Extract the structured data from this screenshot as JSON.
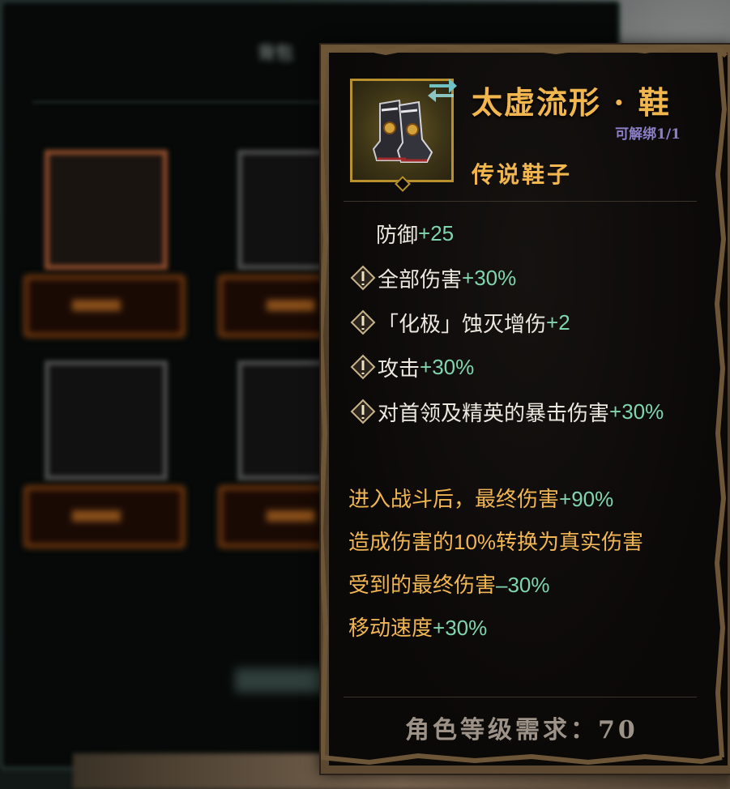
{
  "background": {
    "panel_title": "背包"
  },
  "tooltip": {
    "item_name": "太虚流形 · 鞋",
    "bind_status": "可解绑1/1",
    "item_type": "传说鞋子",
    "item_icon": "boots-icon",
    "swap_icon": "swap-arrows-icon",
    "base_stat": {
      "label": "防御",
      "bonus": "+25"
    },
    "affixes": [
      {
        "label": "全部伤害",
        "bonus": "+30%"
      },
      {
        "label": "「化极」蚀灭增伤",
        "bonus": "+2"
      },
      {
        "label": "攻击",
        "bonus": "+30%"
      },
      {
        "label": "对首领及精英的暴击伤害",
        "bonus": "+30%"
      }
    ],
    "special_effects": [
      {
        "text": "进入战斗后，最终伤害",
        "bonus": "+90%",
        "suffix": ""
      },
      {
        "text": "造成伤害的10%转换为真实伤害",
        "bonus": "",
        "suffix": ""
      },
      {
        "text": "受到的最终伤害",
        "bonus": "–30%",
        "suffix": ""
      },
      {
        "text": "移动速度",
        "bonus": "+30%",
        "suffix": ""
      }
    ],
    "requirement": "角色等级需求：70"
  },
  "colors": {
    "legendary_gold": "#f2b64e",
    "bonus_green": "#7fd6ae",
    "bind_purple": "#8b7fc8",
    "stat_white": "#ece7df",
    "requirement_gray": "#9c9288"
  }
}
